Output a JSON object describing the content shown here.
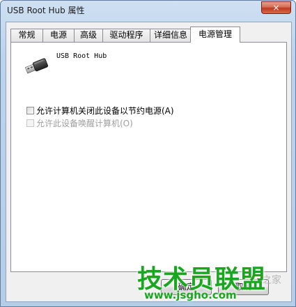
{
  "window": {
    "title": "USB Root Hub 属性",
    "close_symbol": "×"
  },
  "tabs": [
    {
      "label": "常规",
      "active": false
    },
    {
      "label": "电源",
      "active": false
    },
    {
      "label": "高级",
      "active": false
    },
    {
      "label": "驱动程序",
      "active": false
    },
    {
      "label": "详细信息",
      "active": false
    },
    {
      "label": "电源管理",
      "active": true
    }
  ],
  "power_management": {
    "device_icon": "usb-plug-icon",
    "device_name": "USB Root Hub",
    "allow_turn_off": {
      "label": "允许计算机关闭此设备以节约电源(A)",
      "checked": false,
      "enabled": true
    },
    "allow_wake": {
      "label": "允许此设备唤醒计算机(O)",
      "checked": false,
      "enabled": false
    }
  },
  "buttons": {
    "ok": "确定",
    "cancel": "取消"
  },
  "watermark": {
    "logo": "技术员联盟",
    "url": "www.jsgho.com",
    "side_text": "之家"
  }
}
